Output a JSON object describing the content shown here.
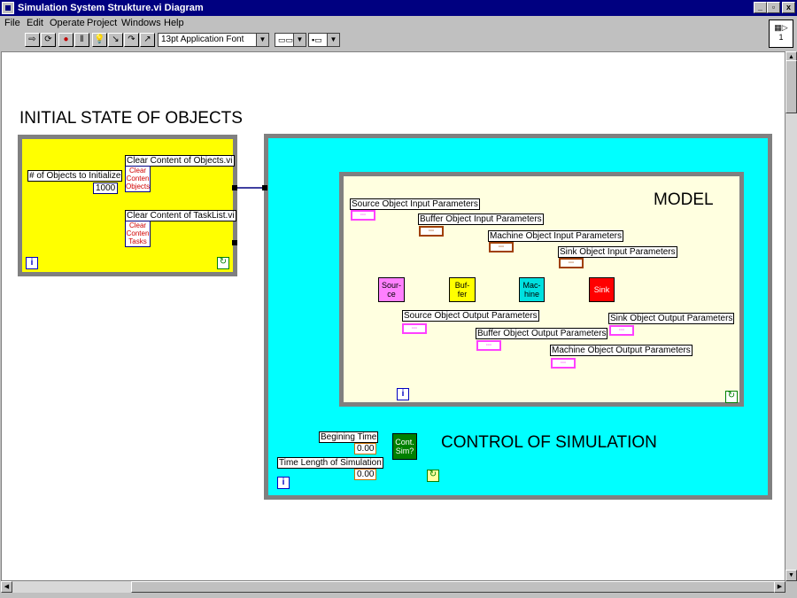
{
  "window": {
    "title": "Simulation System Strukture.vi Diagram",
    "buttons": [
      "_",
      "▫",
      "x"
    ]
  },
  "menu": [
    "File",
    "Edit",
    "Operate",
    "Project",
    "Windows",
    "Help"
  ],
  "toolbar": {
    "font": "13pt Application Font",
    "connector_label": "1"
  },
  "diagram": {
    "initial_state": {
      "heading": "INITIAL STATE OF OBJECTS",
      "objects_label": "# of Objects to Initialize",
      "objects_value": "1000",
      "clear_objects_label": "Clear Content of Objects.vi",
      "clear_objects_icon": [
        "Clear",
        "Conten",
        "Objects"
      ],
      "clear_tasks_label": "Clear Content of TaskList.vi",
      "clear_tasks_icon": [
        "Clear",
        "Conten",
        "Tasks"
      ]
    },
    "model": {
      "heading": "MODEL",
      "source_in": "Source Object Input Parameters",
      "buffer_in": "Buffer Object Input Parameters",
      "machine_in": "Machine Object Input Parameters",
      "sink_in": "Sink Object Input Parameters",
      "source_out": "Source Object Output Parameters",
      "buffer_out": "Buffer Object Output Parameters",
      "machine_out": "Machine Object Output Parameters",
      "sink_out": "Sink Object Output Parameters",
      "source_node": [
        "Sour-",
        "ce"
      ],
      "buffer_node": [
        "Buf-",
        "fer"
      ],
      "machine_node": [
        "Mac-",
        "hine"
      ],
      "sink_node": "Sink"
    },
    "control": {
      "heading": "CONTROL OF SIMULATION",
      "begin_label": "Begining Time",
      "begin_value": "0.00",
      "length_label": "Time Length of Simulation",
      "length_value": "0.00",
      "cont_node": [
        "Cont.",
        "Sim?"
      ]
    },
    "iteration_glyph": "i",
    "condition_glyph": "↻"
  },
  "colors": {
    "initial_bg": "#ffff00",
    "control_bg": "#00ffff",
    "model_bg": "#ffffe0",
    "frame": "#808080",
    "source": "#ff80ff",
    "buffer": "#ffff00",
    "machine": "#00e0e0",
    "sink": "#ff0000",
    "cont": "#008000"
  }
}
